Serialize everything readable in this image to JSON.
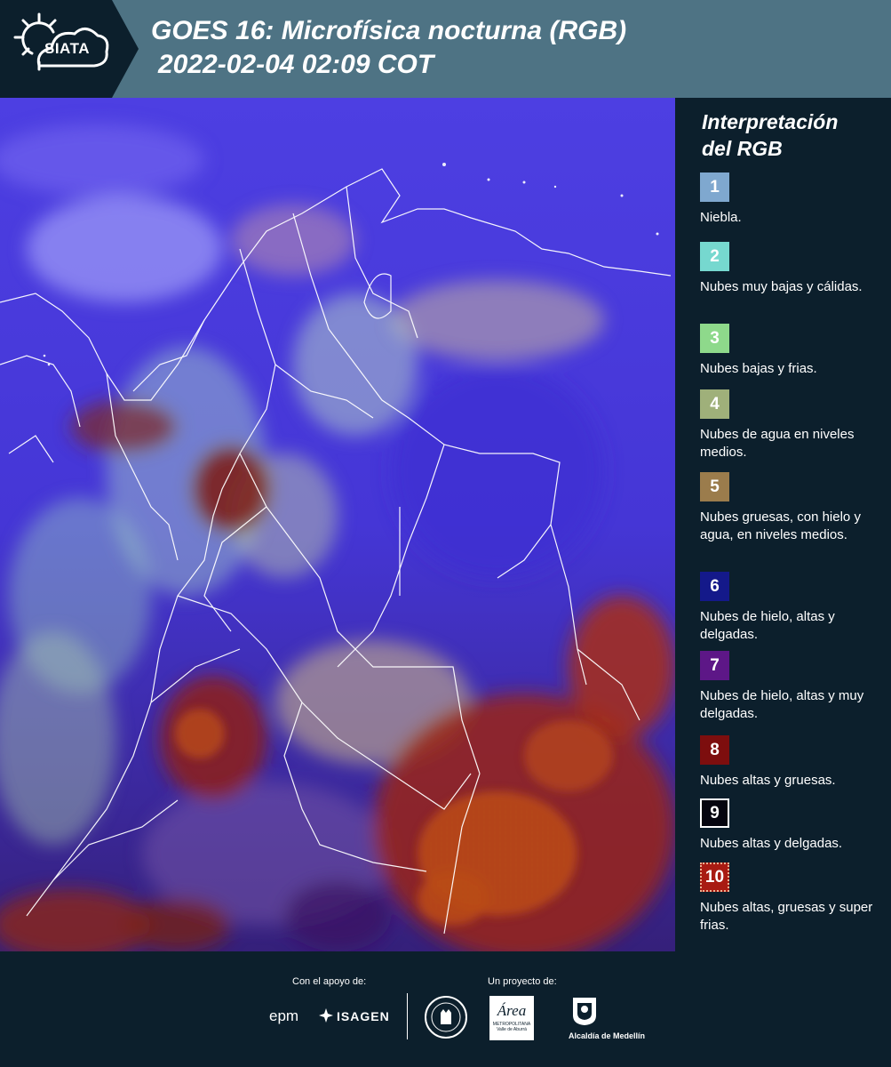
{
  "header": {
    "logo_text": "SIATA",
    "title_line1": "GOES 16: Microfísica nocturna (RGB)",
    "title_line2": "2022-02-04 02:09 COT"
  },
  "legend": {
    "title_line1": "Interpretación",
    "title_line2": "del RGB",
    "items": [
      {
        "num": "1",
        "label": "Niebla.",
        "color": "#7fa8cf"
      },
      {
        "num": "2",
        "label": "Nubes muy bajas y cálidas.",
        "color": "#76d8cf"
      },
      {
        "num": "3",
        "label": "Nubes bajas y frias.",
        "color": "#8ed98b"
      },
      {
        "num": "4",
        "label": "Nubes de agua en niveles medios.",
        "color": "#9fb07a"
      },
      {
        "num": "5",
        "label": "Nubes gruesas, con hielo y agua, en niveles medios.",
        "color": "#9b7c4c"
      },
      {
        "num": "6",
        "label": "Nubes de hielo, altas y delgadas.",
        "color": "#14198a"
      },
      {
        "num": "7",
        "label": "Nubes de hielo, altas y muy delgadas.",
        "color": "#5d1787"
      },
      {
        "num": "8",
        "label": "Nubes altas y gruesas.",
        "color": "#7d0e0e"
      },
      {
        "num": "9",
        "label": "Nubes altas y delgadas.",
        "color": "#05050f"
      },
      {
        "num": "10",
        "label": "Nubes altas, gruesas y super frias.",
        "color": "#a81b12"
      }
    ]
  },
  "footer": {
    "support_label": "Con el apoyo de:",
    "project_label": "Un proyecto de:",
    "sponsor1": "epm",
    "sponsor2": "ISAGEN",
    "partner1": "Área",
    "partner1_sub": "METROPOLITANA",
    "partner1_sub2": "Valle de Aburrá",
    "partner2": "Alcaldía de Medellín"
  },
  "colors": {
    "background": "#0c1f2c",
    "header_band": "#4e7384",
    "map_base": "#4a3fd8"
  }
}
